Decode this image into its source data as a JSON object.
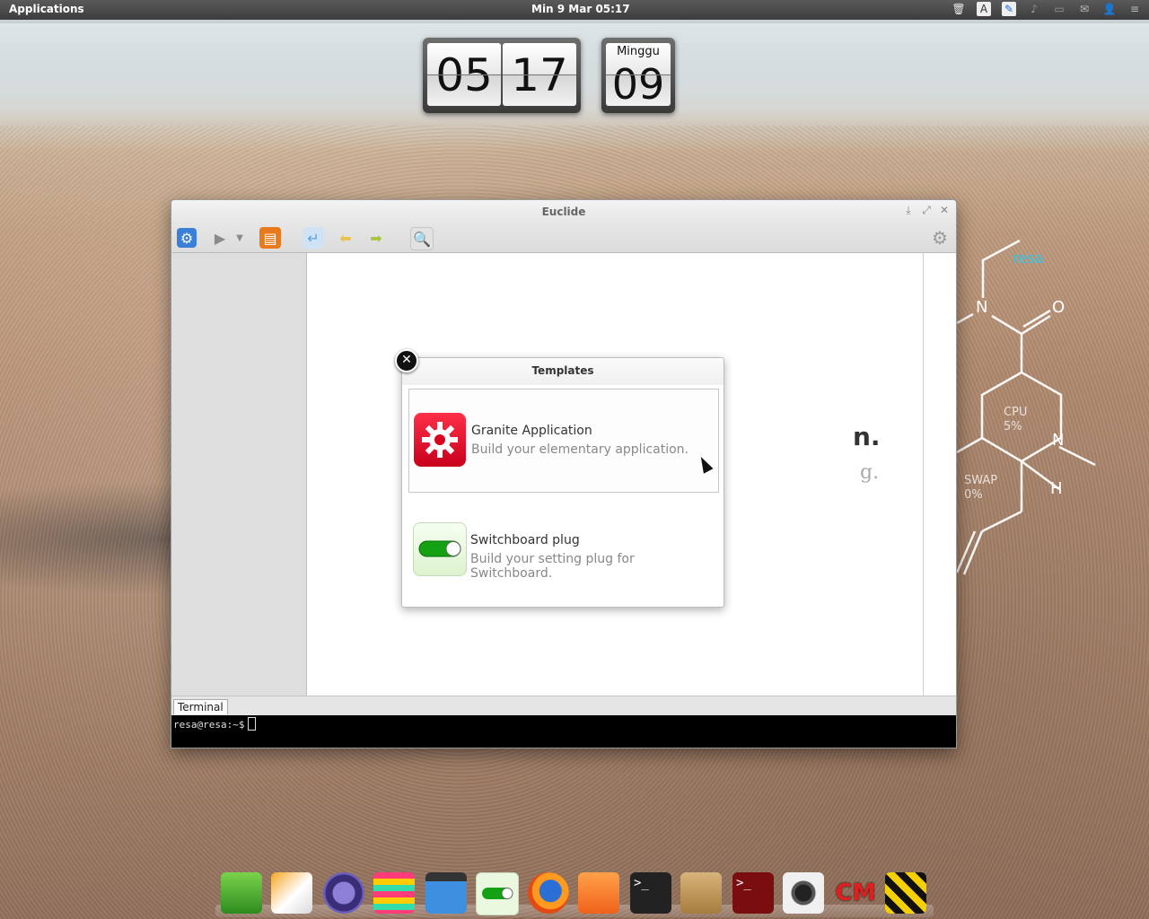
{
  "panel": {
    "applications": "Applications",
    "clock": "Min  9 Mar 05:17",
    "tray": [
      "trash-icon",
      "text-icon",
      "search-icon",
      "sound-icon",
      "display-icon",
      "mail-icon",
      "user-icon",
      "menu-icon"
    ]
  },
  "flipclock": {
    "hours": "05",
    "minutes": "17",
    "day_name": "Minggu",
    "day_number": "09"
  },
  "conky": {
    "user": "resa",
    "cpu_label": "CPU",
    "cpu_value": "5%",
    "swap_label": "SWAP",
    "swap_value": "0%",
    "atoms": {
      "n1": "N",
      "o": "O",
      "n2": "N",
      "h": "H"
    }
  },
  "window": {
    "title": "Euclide",
    "toolbar": [
      "project-settings-icon",
      "run-icon",
      "run-dropdown-icon",
      "open-project-icon",
      "new-line-icon",
      "undo-icon",
      "redo-icon",
      "search-icon",
      "settings-gear-icon"
    ],
    "welcome_partial": "n.",
    "welcome_sub_partial": "g.",
    "bottom_tab": "Terminal",
    "terminal_prompt": "resa@resa:~$"
  },
  "templates": {
    "title": "Templates",
    "items": [
      {
        "name": "Granite Application",
        "description": "Build your elementary application.",
        "color": "#e8112d"
      },
      {
        "name": "Switchboard plug",
        "description": "Build your setting plug for Switchboard.",
        "color": "#1aa81a"
      }
    ]
  },
  "dock": {
    "apps": [
      "midori",
      "paper",
      "eclipse",
      "stacks",
      "video-player",
      "switchboard",
      "firefox",
      "software-center",
      "terminal",
      "calculator",
      "terminal-red",
      "camera",
      "cm-app",
      "construction-app"
    ]
  }
}
